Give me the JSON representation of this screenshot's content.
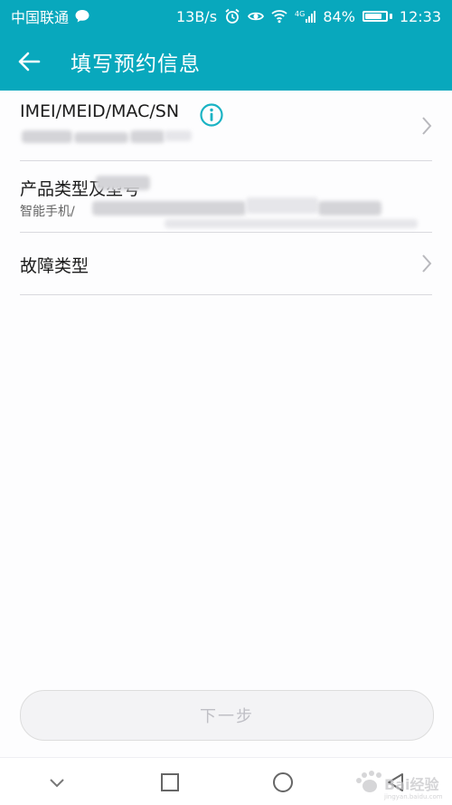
{
  "status_bar": {
    "carrier": "中国联通",
    "net_speed": "13B/s",
    "network_badge": "4G",
    "battery_percent": "84%",
    "battery_level": 0.84,
    "time": "12:33"
  },
  "header": {
    "title": "填写预约信息"
  },
  "rows": [
    {
      "label": "IMEI/MEID/MAC/SN",
      "value": "",
      "has_info": true,
      "has_chevron": true
    },
    {
      "label": "产品类型及型号",
      "value": "智能手机/",
      "has_info": false,
      "has_chevron": false
    },
    {
      "label": "故障类型",
      "value": "",
      "has_info": false,
      "has_chevron": true
    }
  ],
  "footer": {
    "next_label": "下一步"
  },
  "colors": {
    "accent": "#08a8bd",
    "info_icon": "#1ab3c4",
    "disabled_text": "#bfbfc5"
  },
  "icons": [
    "back-arrow-icon",
    "info-icon",
    "chevron-right-icon",
    "nav-back-icon",
    "nav-home-icon",
    "nav-recents-icon",
    "nav-collapse-icon"
  ]
}
